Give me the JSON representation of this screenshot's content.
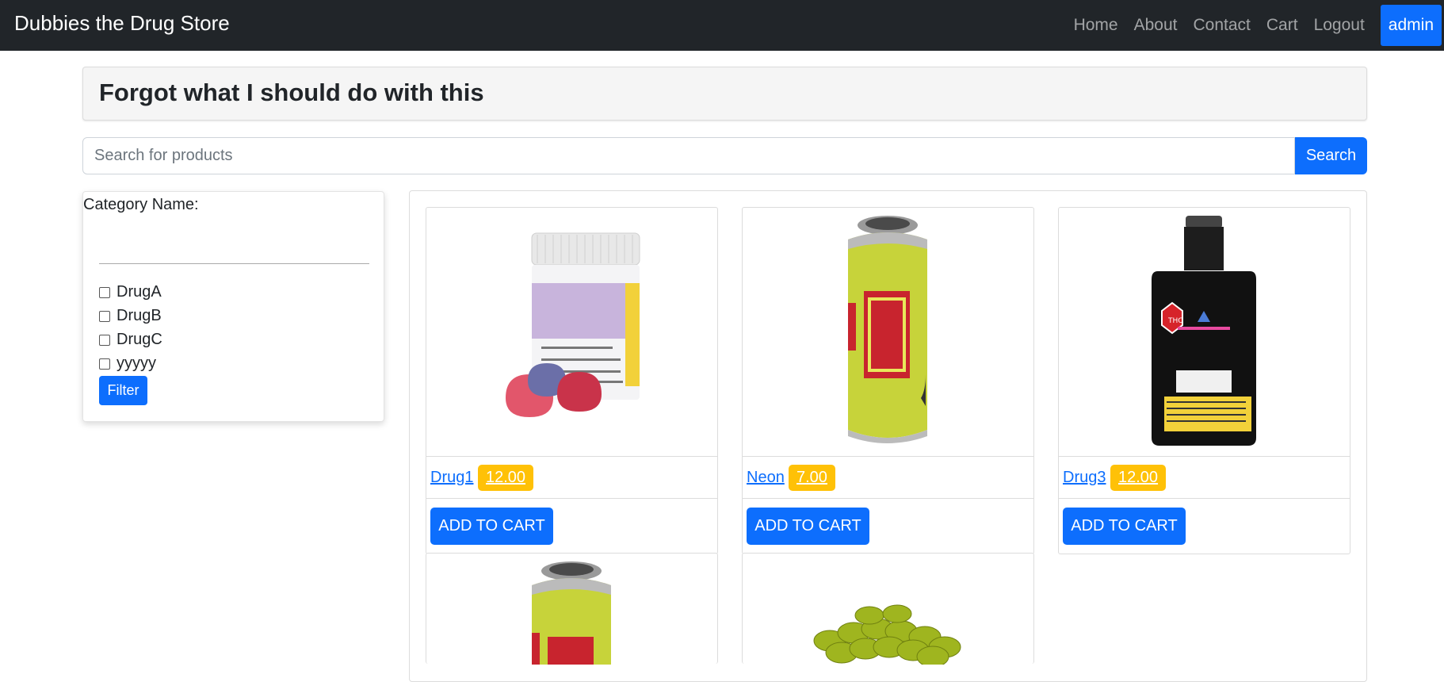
{
  "navbar": {
    "brand": "Dubbies the Drug Store",
    "links": [
      "Home",
      "About",
      "Contact",
      "Cart",
      "Logout"
    ],
    "admin_label": "admin"
  },
  "header": {
    "title": "Forgot what I should do with this"
  },
  "search": {
    "placeholder": "Search for products",
    "value": "",
    "button_label": "Search"
  },
  "sidebar": {
    "category_label": "Category Name:",
    "categories": [
      {
        "label": "DrugA",
        "checked": false
      },
      {
        "label": "DrugB",
        "checked": false
      },
      {
        "label": "DrugC",
        "checked": false
      },
      {
        "label": "yyyyy",
        "checked": false
      }
    ],
    "filter_label": "Filter"
  },
  "products": [
    {
      "name": "Drug1",
      "price": "12.00",
      "add_label": "ADD TO CART",
      "image": "gummies-jar"
    },
    {
      "name": "Neon",
      "price": "7.00",
      "add_label": "ADD TO CART",
      "image": "drink-can"
    },
    {
      "name": "Drug3",
      "price": "12.00",
      "add_label": "ADD TO CART",
      "image": "black-bottle"
    },
    {
      "image": "drink-can"
    },
    {
      "image": "green-softgels"
    }
  ],
  "colors": {
    "navbar_bg": "#212529",
    "primary": "#0d6efd",
    "price_badge": "#ffc107"
  }
}
